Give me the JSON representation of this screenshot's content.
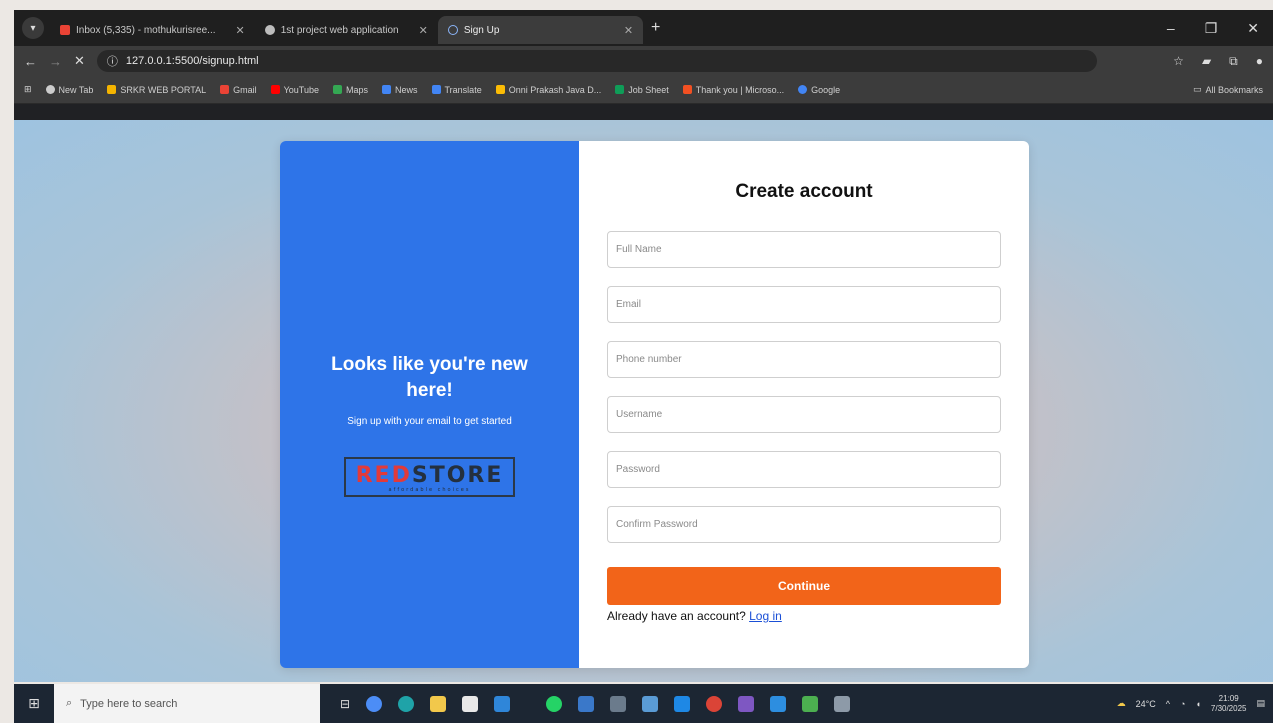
{
  "browser": {
    "tabs": [
      {
        "label": "Inbox (5,335) - mothukurisree...",
        "color": "#ea4335"
      },
      {
        "label": "1st project web application",
        "color": "#bdbdbd"
      },
      {
        "label": "Sign Up",
        "color": "#8ab4f8"
      }
    ],
    "url": "127.0.0.1:5500/signup.html",
    "bookmarks": [
      {
        "label": "New Tab",
        "color": "#cccccc"
      },
      {
        "label": "SRKR WEB PORTAL",
        "color": "#f4b400"
      },
      {
        "label": "Gmail",
        "color": "#ea4335"
      },
      {
        "label": "YouTube",
        "color": "#ff0000"
      },
      {
        "label": "Maps",
        "color": "#34a853"
      },
      {
        "label": "News",
        "color": "#4285f4"
      },
      {
        "label": "Translate",
        "color": "#4285f4"
      },
      {
        "label": "Onni Prakash Java D...",
        "color": "#fbbc05"
      },
      {
        "label": "Job Sheet",
        "color": "#0f9d58"
      },
      {
        "label": "Thank you | Microso...",
        "color": "#f25022"
      },
      {
        "label": "Google",
        "color": "#4285f4"
      }
    ],
    "all_bookmarks": "All Bookmarks"
  },
  "signup": {
    "left": {
      "title": "Looks like you're new here!",
      "subtitle": "Sign up with your email to get started",
      "logo_red": "RED",
      "logo_dark": "STORE",
      "logo_tag": "affordable choices"
    },
    "title": "Create account",
    "fields": {
      "full_name": "Full Name",
      "email": "Email",
      "phone": "Phone number",
      "username": "Username",
      "password": "Password",
      "confirm_password": "Confirm Password"
    },
    "continue": "Continue",
    "have_account": "Already have an account?",
    "login": "Log in"
  },
  "taskbar": {
    "search_placeholder": "Type here to search",
    "weather": "24°C",
    "time": "21:09",
    "date": "7/30/2025"
  },
  "colors": {
    "left_panel": "#2e74e8",
    "continue_button": "#f26419",
    "link": "#1a4fd6"
  }
}
